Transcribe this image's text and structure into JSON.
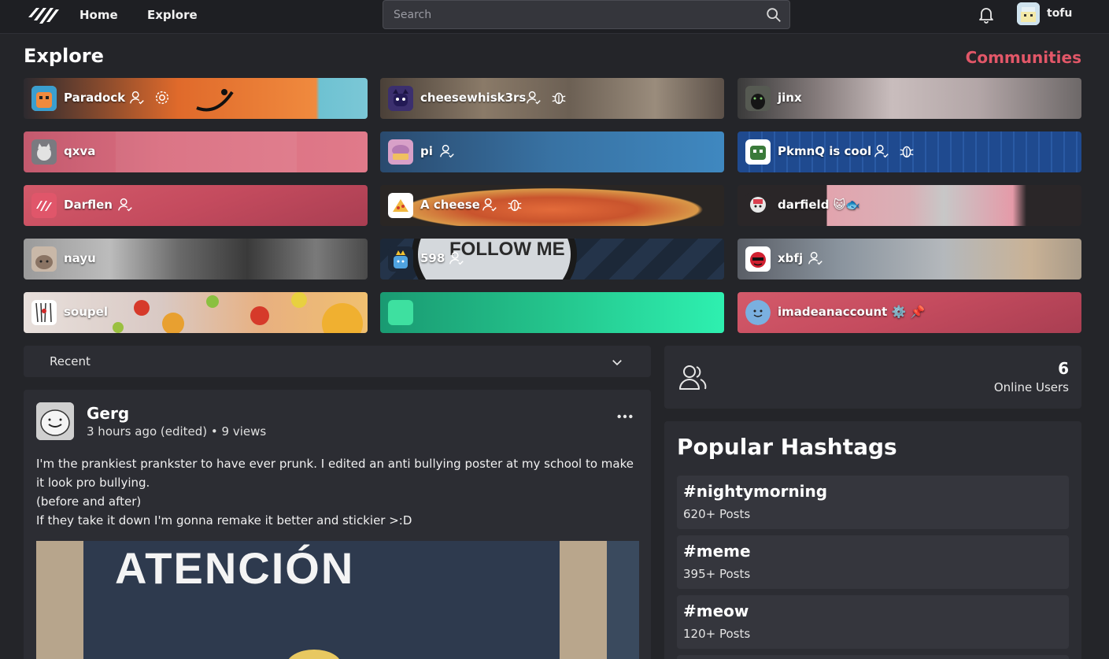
{
  "nav": {
    "home_label": "Home",
    "explore_label": "Explore",
    "search_placeholder": "Search",
    "username": "tofu"
  },
  "explore": {
    "title": "Explore",
    "communities_link": "Communities"
  },
  "communities": [
    {
      "name": "Paradock",
      "icons": [
        "follow-icon",
        "settings-icon"
      ],
      "bg": "orange-blue"
    },
    {
      "name": "cheesewhisk3rs",
      "icons": [
        "follow-icon",
        "bug-icon"
      ],
      "bg": "rock"
    },
    {
      "name": "jinx",
      "icons": [],
      "bg": "cats"
    },
    {
      "name": "qxva",
      "icons": [],
      "bg": "pink-screenshot"
    },
    {
      "name": "pi",
      "icons": [
        "follow-icon"
      ],
      "bg": "blue"
    },
    {
      "name": "PkmnQ is cool",
      "icons": [
        "follow-icon",
        "bug-icon"
      ],
      "bg": "game"
    },
    {
      "name": "Darflen",
      "icons": [
        "follow-icon"
      ],
      "bg": "red-mountain"
    },
    {
      "name": "A cheese",
      "icons": [
        "follow-icon",
        "bug-icon"
      ],
      "bg": "pizza"
    },
    {
      "name": "darfield 😺🐟",
      "icons": [],
      "bg": "cartoon"
    },
    {
      "name": "nayu",
      "icons": [],
      "bg": "gray-photo"
    },
    {
      "name": "598",
      "icons": [
        "follow-icon"
      ],
      "bg": "follow-me"
    },
    {
      "name": "xbfj",
      "icons": [
        "follow-icon"
      ],
      "bg": "sky"
    },
    {
      "name": "soupel",
      "icons": [],
      "bg": "balls"
    },
    {
      "name": "",
      "icons": [],
      "bg": "teal"
    },
    {
      "name": "imadeanaccount ⚙️ 📌",
      "icons": [],
      "bg": "red-mountain"
    }
  ],
  "feed": {
    "sort_label": "Recent"
  },
  "post": {
    "author": "Gerg",
    "meta": "3 hours ago (edited) • 9 views",
    "lines": [
      "I'm the prankiest prankster to have ever prunk. I edited an anti bullying poster at my school to make it look pro bullying.",
      "(before and after)",
      "If they take it down I'm gonna remake it better and stickier >:D"
    ],
    "image_text": "ATENCIÓN"
  },
  "online": {
    "count": "6",
    "label": "Online Users"
  },
  "hashtags": {
    "title": "Popular Hashtags",
    "items": [
      {
        "tag": "#nightymorning",
        "count": "620+ Posts"
      },
      {
        "tag": "#meme",
        "count": "395+ Posts"
      },
      {
        "tag": "#meow",
        "count": "120+ Posts"
      }
    ]
  },
  "colors": {
    "accent": "#e25768",
    "page_bg": "#242529",
    "panel_bg": "#2c2d33"
  }
}
